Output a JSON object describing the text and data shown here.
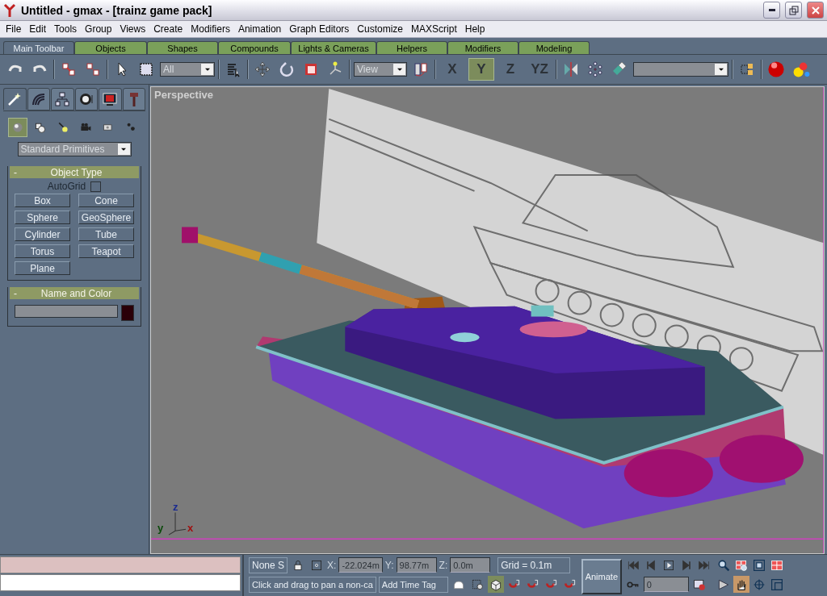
{
  "window": {
    "title": "Untitled - gmax - [trainz game pack]"
  },
  "menu": [
    "File",
    "Edit",
    "Tools",
    "Group",
    "Views",
    "Create",
    "Modifiers",
    "Animation",
    "Graph Editors",
    "Customize",
    "MAXScript",
    "Help"
  ],
  "toolbar_tabs": [
    {
      "label": "Main Toolbar",
      "selected": true
    },
    {
      "label": "Objects",
      "selected": false
    },
    {
      "label": "Shapes",
      "selected": false
    },
    {
      "label": "Compounds",
      "selected": false
    },
    {
      "label": "Lights & Cameras",
      "selected": false
    },
    {
      "label": "Helpers",
      "selected": false
    },
    {
      "label": "Modifiers",
      "selected": false
    },
    {
      "label": "Modeling",
      "selected": false
    }
  ],
  "toolbar": {
    "selection_filter": "All",
    "coordinate_system": "View",
    "axes": [
      {
        "label": "X",
        "selected": false
      },
      {
        "label": "Y",
        "selected": true
      },
      {
        "label": "Z",
        "selected": false
      },
      {
        "label": "YZ",
        "selected": false
      }
    ]
  },
  "command_panel": {
    "tabs": [
      {
        "selected": true
      },
      {
        "selected": false
      },
      {
        "selected": false
      },
      {
        "selected": false
      },
      {
        "selected": false
      },
      {
        "selected": false
      }
    ],
    "categories": [
      {
        "selected": true
      },
      {
        "selected": false
      },
      {
        "selected": false
      },
      {
        "selected": false
      },
      {
        "selected": false
      },
      {
        "selected": false
      }
    ],
    "dropdown": "Standard Primitives",
    "object_type": {
      "title": "Object Type",
      "collapse": "-",
      "autogrid": {
        "label": "AutoGrid",
        "checked": false
      },
      "buttons": [
        "Box",
        "Cone",
        "Sphere",
        "GeoSphere",
        "Cylinder",
        "Tube",
        "Torus",
        "Teapot",
        "Plane"
      ]
    },
    "name_and_color": {
      "title": "Name and Color",
      "collapse": "-",
      "color": "#2a0008"
    }
  },
  "viewport": {
    "label": "Perspective",
    "axes": [
      "z",
      "y",
      "x"
    ]
  },
  "status": {
    "selection": "None S",
    "coords": [
      {
        "label": "X:",
        "value": "-22.024m"
      },
      {
        "label": "Y:",
        "value": "98.77m"
      },
      {
        "label": "Z:",
        "value": "0.0m"
      }
    ],
    "grid": "Grid = 0.1m",
    "prompt": "Click and drag to pan a non-ca",
    "time_tag": "Add Time Tag",
    "animate": "Animate",
    "frame": "0"
  }
}
